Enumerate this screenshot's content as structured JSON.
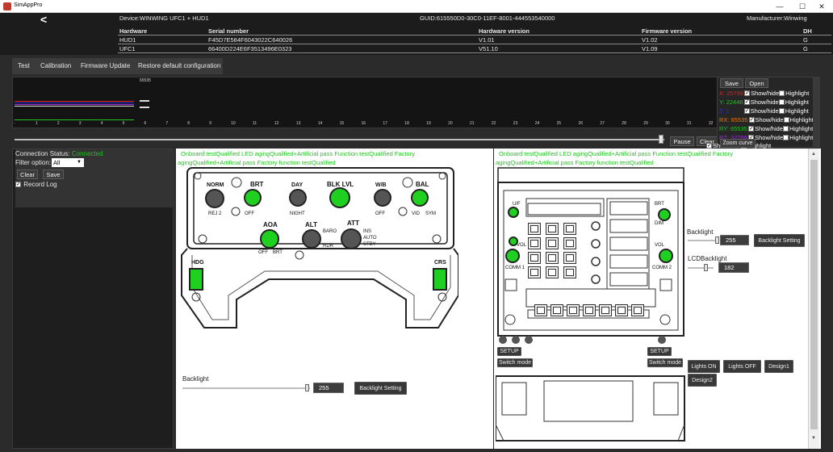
{
  "app": {
    "title": "SimAppPro"
  },
  "window": {
    "minimize": "—",
    "maximize": "☐",
    "close": "✕"
  },
  "header": {
    "back": "<",
    "device": "Device:WINWING UFC1 + HUD1",
    "guid": "GUID:615550D0-30C0-11EF-8001-444553540000",
    "manufacturer": "Manufacturer:Winwing",
    "columns": [
      "Hardware",
      "Serial number",
      "Hardware version",
      "Firmware version",
      "DH"
    ],
    "rows": [
      [
        "HUD1",
        "F45D7E584F6043022C640026",
        "V1.01",
        "V1.02",
        "G"
      ],
      [
        "UFC1",
        "66400D224E6F3513496E0323",
        "V51.10",
        "V1.09",
        "G"
      ]
    ]
  },
  "tabs": [
    "Test",
    "Calibration",
    "Firmware Update",
    "Restore default configuration"
  ],
  "graph": {
    "max_label": "65535",
    "ticks": [
      "1",
      "2",
      "3",
      "4",
      "5",
      "6",
      "7",
      "8",
      "9",
      "10",
      "11",
      "12",
      "13",
      "14",
      "15",
      "16",
      "17",
      "18",
      "19",
      "20",
      "21",
      "22",
      "23",
      "24",
      "25",
      "26",
      "27",
      "28",
      "29",
      "30",
      "31",
      "32"
    ],
    "pause": "Pause",
    "clear": "Clear",
    "legend_colors": {
      "X": "#e02020",
      "Y": "#22c322",
      "Z": "#2a2ae0",
      "RX": "#e07a10",
      "RY": "#22c322",
      "RZ": "#9b30d9"
    }
  },
  "legend": {
    "save": "Save",
    "open": "Open",
    "zoom": "Zoom curve",
    "rows": [
      {
        "axis": "X:",
        "value": "25798",
        "color": "#e02020",
        "show": "Show/hide",
        "highlight": "Highlight"
      },
      {
        "axis": "Y:",
        "value": "22446",
        "color": "#22c322",
        "show": "Show/hide",
        "highlight": "Highlight"
      },
      {
        "axis": "Z:",
        "value": "1",
        "color": "#2a2ae0",
        "show": "Show/hide",
        "highlight": "Highlight"
      },
      {
        "axis": "RX:",
        "value": "65535",
        "color": "#e07a10",
        "show": "Show/hide",
        "highlight": "Highlight"
      },
      {
        "axis": "RY:",
        "value": "65535",
        "color": "#22c322",
        "show": "Show/hide",
        "highlight": "Highlight"
      },
      {
        "axis": "RZ:",
        "value": "32768",
        "color": "#9b30d9",
        "show": "Show/hide",
        "highlight": "Highlight"
      },
      {
        "axis": "",
        "value": "",
        "color": "#ffffff",
        "show": "Show/hide",
        "highlight": "Highlight"
      }
    ]
  },
  "connection": {
    "status_label": "Connection Status:",
    "status_value": "Connected",
    "filter_label": "Filter option:",
    "filter_value": "All",
    "clear": "Clear",
    "save": "Save",
    "record_log": "Record Log"
  },
  "hud": {
    "status_line1": "Onboard testQualified   LED agingQualified+Artificial pass   Function testQualified Factory",
    "status_line2": "agingQualified+Artificial pass   Factory function testQualified",
    "backlight_label": "Backlight",
    "backlight_value": "255",
    "backlight_fraction": 0.98,
    "backlight_button": "Backlight Setting",
    "labels": {
      "norm": "NORM",
      "rej2": "REJ 2",
      "brt": "BRT",
      "off1": "OFF",
      "day": "DAY",
      "night": "NIGHT",
      "blk": "BLK LVL",
      "wb": "W/B",
      "off2": "OFF",
      "bal": "BAL",
      "vid": "VID",
      "sym": "SYM",
      "aoa": "AOA",
      "off3": "OFF",
      "brt2": "BRT",
      "alt": "ALT",
      "baro": "BARO",
      "rdr": "RDR",
      "att": "ATT",
      "ins": "INS",
      "auto": "AUTO",
      "stby": "STBY",
      "hdg": "HDG",
      "crs": "CRS"
    }
  },
  "ufc": {
    "status_line1": "Onboard testQualified   LED agingQualified+Artificial pass   Function testQualified Factory",
    "status_line2": "agingQualified+Artificial pass   Factory function testQualified",
    "backlight_label": "Backlight",
    "backlight_value": "255",
    "backlight_fraction": 0.98,
    "backlight_button": "Backlight Setting",
    "lcd_label": "LCDBacklight",
    "lcd_value": "182",
    "lcd_fraction": 0.71,
    "setup1": "SETUP",
    "switch1": "Switch mode",
    "setup2": "SETUP",
    "switch2": "Switch mode",
    "lights_on": "Lights ON",
    "lights_off": "Lights OFF",
    "design1": "Design1",
    "design2": "Design2",
    "labels": {
      "uf": "U/F",
      "brt": "BRT",
      "dim": "DIM",
      "vol": "VOL",
      "vol2": "VOL",
      "comm1": "COMM 1",
      "comm2": "COMM 2"
    }
  }
}
